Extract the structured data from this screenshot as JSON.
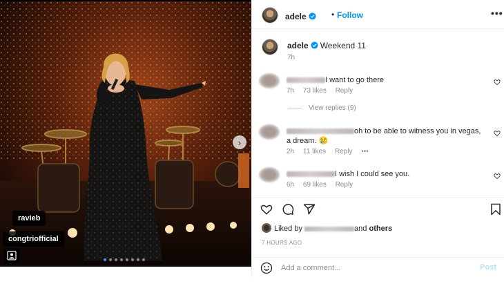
{
  "post": {
    "author": "adele",
    "follow_label": "Follow",
    "more_label": "•••",
    "separator": "•",
    "photo_tags": [
      "ravieb",
      "congtriofficial"
    ],
    "carousel_count": 8,
    "carousel_active_index": 0
  },
  "caption": {
    "username": "adele",
    "text": "Weekend 11",
    "time": "7h"
  },
  "comments": [
    {
      "text": "I want to go there",
      "time": "7h",
      "likes": "73 likes",
      "reply_label": "Reply",
      "view_replies": "View replies (9)"
    },
    {
      "text": "oh to be able to witness you in vegas, a dream. 😢",
      "time": "2h",
      "likes": "11 likes",
      "reply_label": "Reply",
      "more": "•••"
    },
    {
      "text": "I wish I could see you.",
      "time": "6h",
      "likes": "69 likes",
      "reply_label": "Reply"
    }
  ],
  "liked_by": {
    "prefix": "Liked by",
    "suffix": "and",
    "others": "others"
  },
  "post_time": "7 HOURS AGO",
  "comment_box": {
    "placeholder": "Add a comment...",
    "post_label": "Post"
  },
  "icons": {
    "verified": "verified-badge-icon",
    "heart": "heart-icon",
    "comment": "comment-icon",
    "share": "share-icon",
    "save": "bookmark-icon",
    "emoji": "emoji-icon",
    "user_tag": "user-tag-icon",
    "next": "chevron-right-icon"
  },
  "colors": {
    "accent": "#0095f6",
    "post_disabled": "#b2dffc",
    "muted": "#8e8e8e"
  }
}
